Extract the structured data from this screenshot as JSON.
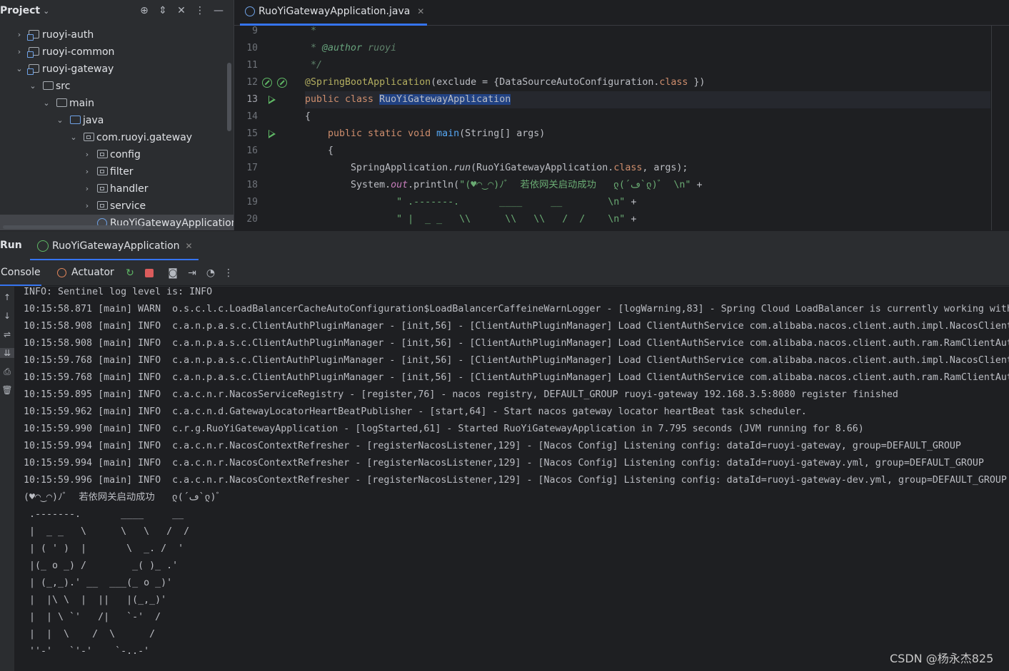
{
  "project": {
    "title": "Project",
    "tree": [
      {
        "label": "ruoyi-auth",
        "chevron": "›"
      },
      {
        "label": "ruoyi-common",
        "chevron": "›"
      },
      {
        "label": "ruoyi-gateway",
        "chevron": "⌄"
      },
      {
        "label": "src",
        "chevron": "⌄"
      },
      {
        "label": "main",
        "chevron": "⌄"
      },
      {
        "label": "java",
        "chevron": "⌄"
      },
      {
        "label": "com.ruoyi.gateway",
        "chevron": "⌄"
      },
      {
        "label": "config",
        "chevron": "›"
      },
      {
        "label": "filter",
        "chevron": "›"
      },
      {
        "label": "handler",
        "chevron": "›"
      },
      {
        "label": "service",
        "chevron": "›"
      },
      {
        "label": "RuoYiGatewayApplication",
        "chevron": ""
      }
    ],
    "header_icons": [
      "crosshair-icon",
      "expand-collapse-icon",
      "collapse-all-icon",
      "more-icon",
      "minimize-icon"
    ]
  },
  "editor": {
    "tab": "RuoYiGatewayApplication.java",
    "line_numbers": [
      "9",
      "10",
      "11",
      "12",
      "13",
      "14",
      "15",
      "16",
      "17",
      "18",
      "19",
      "20"
    ],
    "code": {
      "l9": " *",
      "l10_a": " * ",
      "l10_tag": "@author",
      "l10_b": " ruoyi",
      "l11": " */",
      "l12_ann": "@SpringBootApplication",
      "l12_a": "(exclude = {DataSourceAutoConfiguration.",
      "l12_kw": "class",
      "l12_b": " })",
      "l13_kw": "public class ",
      "l13_name": "RuoYiGatewayApplication",
      "l14": "{",
      "l15_kw": "    public static void ",
      "l15_fn": "main",
      "l15_b": "(String[] args)",
      "l16": "    {",
      "l17_a": "        SpringApplication.",
      "l17_fn": "run",
      "l17_b": "(RuoYiGatewayApplication.",
      "l17_kw": "class",
      "l17_c": ", args);",
      "l18_a": "        System.",
      "l18_st": "out",
      "l18_b": ".println(",
      "l18_str": "\"(♥◠‿◠)ﾉﾞ  若依网关启动成功   ლ(´ڡ`ლ)ﾞ  \\n\"",
      "l18_c": " +",
      "l19_str": "                \" .-------.       ____     __        \\n\"",
      "l19_c": " +",
      "l20_str": "                \" |  _ _   \\\\      \\\\   \\\\   /  /    \\n\"",
      "l20_c": " +"
    }
  },
  "run": {
    "title": "Run",
    "tab": "RuoYiGatewayApplication",
    "console_tab": "Console",
    "actuator_tab": "Actuator",
    "output": [
      "INFO: Sentinel log level is: INFO",
      "10:15:58.871 [main] WARN  o.s.c.l.c.LoadBalancerCacheAutoConfiguration$LoadBalancerCaffeineWarnLogger - [logWarning,83] - Spring Cloud LoadBalancer is currently working with",
      "10:15:58.908 [main] INFO  c.a.n.p.a.s.c.ClientAuthPluginManager - [init,56] - [ClientAuthPluginManager] Load ClientAuthService com.alibaba.nacos.client.auth.impl.NacosClient",
      "10:15:58.908 [main] INFO  c.a.n.p.a.s.c.ClientAuthPluginManager - [init,56] - [ClientAuthPluginManager] Load ClientAuthService com.alibaba.nacos.client.auth.ram.RamClientAut",
      "10:15:59.768 [main] INFO  c.a.n.p.a.s.c.ClientAuthPluginManager - [init,56] - [ClientAuthPluginManager] Load ClientAuthService com.alibaba.nacos.client.auth.impl.NacosClient",
      "10:15:59.768 [main] INFO  c.a.n.p.a.s.c.ClientAuthPluginManager - [init,56] - [ClientAuthPluginManager] Load ClientAuthService com.alibaba.nacos.client.auth.ram.RamClientAut",
      "10:15:59.895 [main] INFO  c.a.c.n.r.NacosServiceRegistry - [register,76] - nacos registry, DEFAULT_GROUP ruoyi-gateway 192.168.3.5:8080 register finished",
      "10:15:59.962 [main] INFO  c.a.c.n.d.GatewayLocatorHeartBeatPublisher - [start,64] - Start nacos gateway locator heartBeat task scheduler.",
      "10:15:59.990 [main] INFO  c.r.g.RuoYiGatewayApplication - [logStarted,61] - Started RuoYiGatewayApplication in 7.795 seconds (JVM running for 8.66)",
      "10:15:59.994 [main] INFO  c.a.c.n.r.NacosContextRefresher - [registerNacosListener,129] - [Nacos Config] Listening config: dataId=ruoyi-gateway, group=DEFAULT_GROUP",
      "10:15:59.994 [main] INFO  c.a.c.n.r.NacosContextRefresher - [registerNacosListener,129] - [Nacos Config] Listening config: dataId=ruoyi-gateway.yml, group=DEFAULT_GROUP",
      "10:15:59.996 [main] INFO  c.a.c.n.r.NacosContextRefresher - [registerNacosListener,129] - [Nacos Config] Listening config: dataId=ruoyi-gateway-dev.yml, group=DEFAULT_GROUP",
      "(♥◠‿◠)ﾉﾞ  若依网关启动成功   ლ(´ڡ`ლ)ﾞ",
      " .-------.       ____     __",
      " |  _ _   \\      \\   \\   /  /",
      " | ( ' )  |       \\  _. /  '",
      " |(_ o _) /        _( )_ .'",
      " | (_,_).' __  ___(_ o _)'",
      " |  |\\ \\  |  ||   |(_,_)'",
      " |  | \\ `'   /|   `-'  /",
      " |  |  \\    /  \\      /",
      " ''-'   `'-'    `-..-'"
    ]
  },
  "watermark": "CSDN @杨永杰825"
}
